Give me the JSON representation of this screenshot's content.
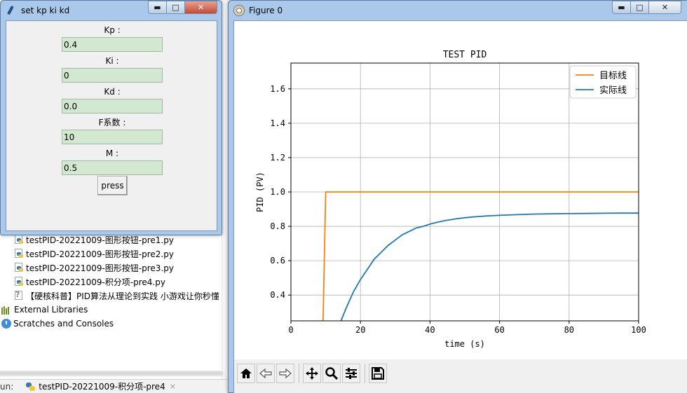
{
  "ide": {
    "project_items": [
      {
        "label": "testPID-20221009-图形按钮-pre1.py",
        "icon": "python-file-icon"
      },
      {
        "label": "testPID-20221009-图形按钮-pre2.py",
        "icon": "python-file-icon"
      },
      {
        "label": "testPID-20221009-图形按钮-pre3.py",
        "icon": "python-file-icon"
      },
      {
        "label": "testPID-20221009-积分项-pre4.py",
        "icon": "python-file-icon"
      },
      {
        "label": "【硬核科普】PID算法从理论到实践 小游戏让你秒懂",
        "icon": "unknown-file-icon"
      }
    ],
    "external_libraries": "External Libraries",
    "scratches": "Scratches and Consoles",
    "run_label": "un:",
    "run_tab": "testPID-20221009-积分项-pre4",
    "run_tab_close": "×"
  },
  "tk_dialog": {
    "title": "set kp ki kd",
    "fields": [
      {
        "label": "Kp :",
        "value": "0.4"
      },
      {
        "label": "Ki :",
        "value": "0"
      },
      {
        "label": "Kd :",
        "value": "0.0"
      },
      {
        "label": "F系数 :",
        "value": "10"
      },
      {
        "label": "M :",
        "value": "0.5"
      }
    ],
    "button": "press",
    "entry_bg": "#d2e8d0"
  },
  "figure_window": {
    "title": "Figure 0",
    "toolbar": [
      "home-icon",
      "back-icon",
      "forward-icon",
      "pan-icon",
      "zoom-icon",
      "subplots-icon",
      "save-icon"
    ]
  },
  "chart_data": {
    "type": "line",
    "title": "TEST PID",
    "xlabel": "time (s)",
    "ylabel": "PID (PV)",
    "xlim": [
      0,
      100
    ],
    "ylim": [
      0.25,
      1.75
    ],
    "xticks": [
      0,
      20,
      40,
      60,
      80,
      100
    ],
    "yticks": [
      0.4,
      0.6,
      0.8,
      1.0,
      1.2,
      1.4,
      1.6
    ],
    "grid": true,
    "legend": "top-right",
    "series": [
      {
        "name": "目标线",
        "color": "#ff7f0e",
        "x": [
          0,
          9,
          10,
          100
        ],
        "y": [
          0,
          0,
          1.0,
          1.0
        ]
      },
      {
        "name": "实际线",
        "color": "#1f77b4",
        "x": [
          10,
          12,
          14,
          16,
          18,
          20,
          22,
          24,
          26,
          28,
          30,
          32,
          34,
          36,
          38,
          40,
          42,
          44,
          46,
          48,
          50,
          52,
          54,
          56,
          58,
          60,
          65,
          70,
          75,
          80,
          85,
          90,
          95,
          100
        ],
        "y": [
          0.0,
          0.12,
          0.23,
          0.33,
          0.42,
          0.49,
          0.55,
          0.61,
          0.65,
          0.69,
          0.72,
          0.75,
          0.77,
          0.79,
          0.8,
          0.813,
          0.823,
          0.832,
          0.839,
          0.845,
          0.85,
          0.854,
          0.857,
          0.86,
          0.862,
          0.864,
          0.868,
          0.871,
          0.873,
          0.874,
          0.875,
          0.876,
          0.877,
          0.877
        ]
      }
    ]
  }
}
